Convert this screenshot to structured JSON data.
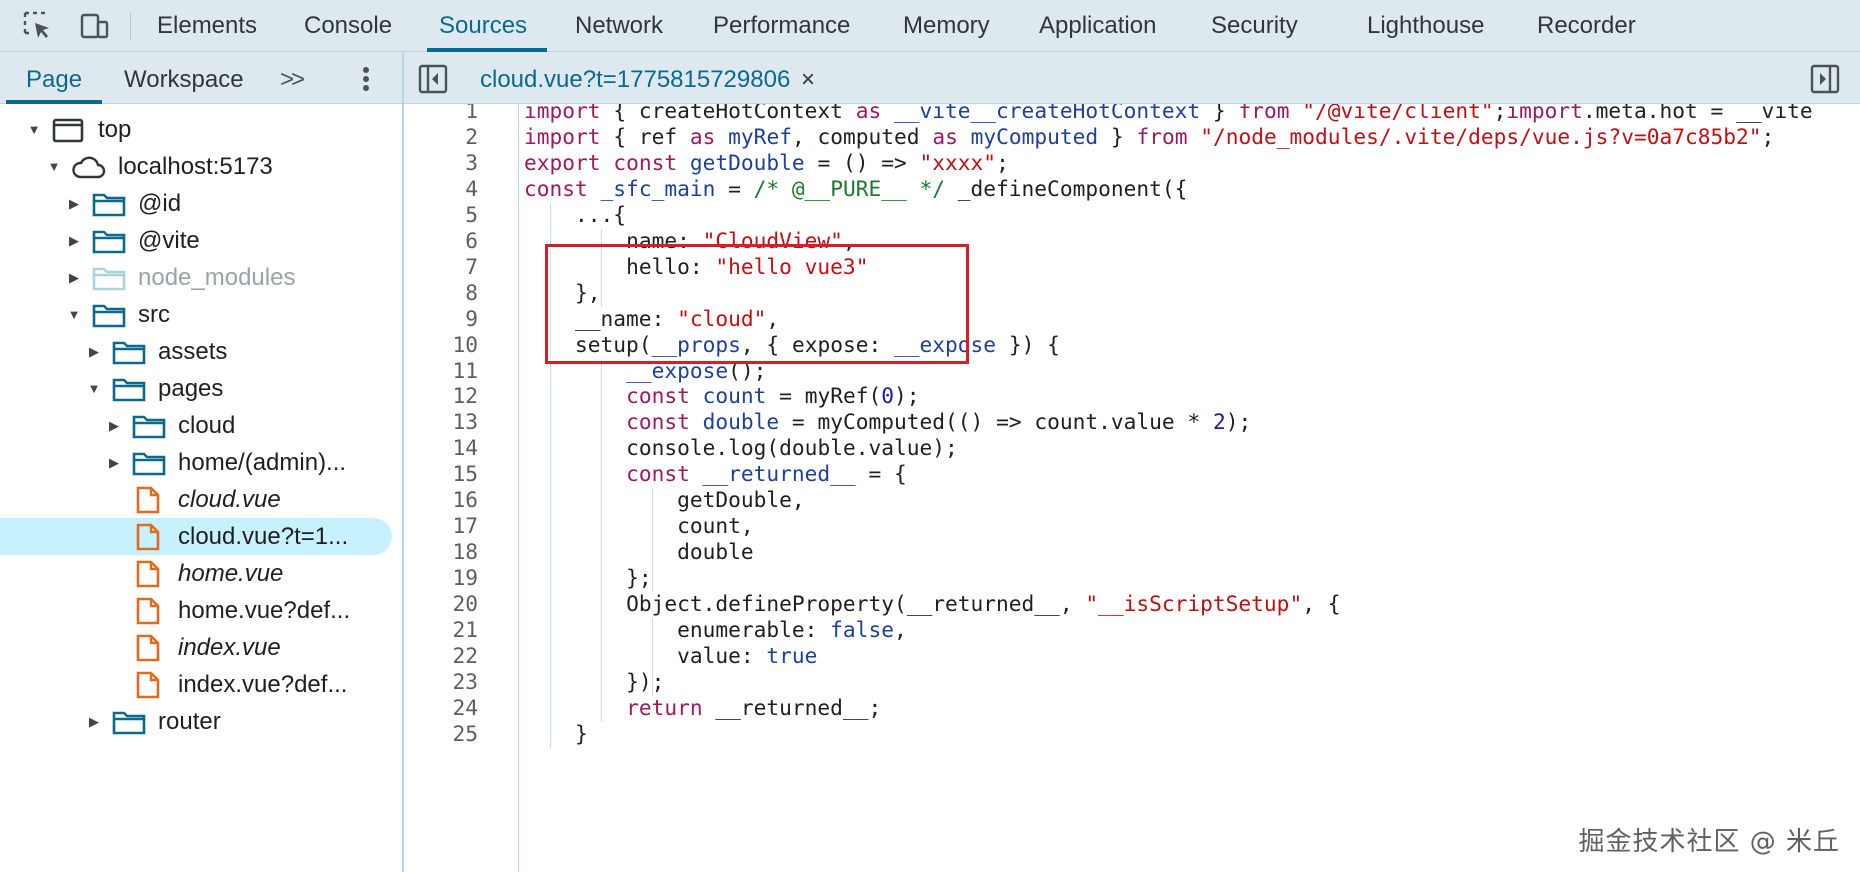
{
  "toolbar": {
    "tabs": [
      "Elements",
      "Console",
      "Sources",
      "Network",
      "Performance",
      "Memory",
      "Application",
      "Security",
      "Lighthouse",
      "Recorder"
    ],
    "active_tab": "Sources"
  },
  "navigator": {
    "tabs": [
      "Page",
      "Workspace"
    ],
    "more_label": ">>",
    "active_tab": "Page",
    "tree": [
      {
        "label": "top",
        "type": "frame",
        "expanded": true
      },
      {
        "label": "localhost:5173",
        "type": "cloud",
        "expanded": true
      },
      {
        "label": "@id",
        "type": "folder",
        "expanded": false
      },
      {
        "label": "@vite",
        "type": "folder",
        "expanded": false
      },
      {
        "label": "node_modules",
        "type": "folder",
        "expanded": false,
        "dimmed": true
      },
      {
        "label": "src",
        "type": "folder",
        "expanded": true
      },
      {
        "label": "assets",
        "type": "folder",
        "expanded": false
      },
      {
        "label": "pages",
        "type": "folder",
        "expanded": true
      },
      {
        "label": "cloud",
        "type": "folder",
        "expanded": false
      },
      {
        "label": "home/(admin)...",
        "type": "folder",
        "expanded": false
      },
      {
        "label": "cloud.vue",
        "type": "file",
        "italic": true
      },
      {
        "label": "cloud.vue?t=1...",
        "type": "file",
        "selected": true
      },
      {
        "label": "home.vue",
        "type": "file",
        "italic": true
      },
      {
        "label": "home.vue?def...",
        "type": "file"
      },
      {
        "label": "index.vue",
        "type": "file",
        "italic": true
      },
      {
        "label": "index.vue?def...",
        "type": "file"
      },
      {
        "label": "router",
        "type": "folder",
        "expanded": false
      }
    ]
  },
  "editor": {
    "file_tab": "cloud.vue?t=1775815729806",
    "close_icon": "×",
    "line_numbers": [
      "1",
      "2",
      "3",
      "4",
      "5",
      "6",
      "7",
      "8",
      "9",
      "10",
      "11",
      "12",
      "13",
      "14",
      "15",
      "16",
      "17",
      "18",
      "19",
      "20",
      "21",
      "22",
      "23",
      "24",
      "25"
    ],
    "code": [
      "import { createHotContext as __vite__createHotContext } from \"/@vite/client\";import.meta.hot = __vite",
      "import { ref as myRef, computed as myComputed } from \"/node_modules/.vite/deps/vue.js?v=0a7c85b2\";",
      "export const getDouble = () => \"xxxx\";",
      "const _sfc_main = /* @__PURE__ */ _defineComponent({",
      "    ...{",
      "        name: \"CloudView\",",
      "        hello: \"hello vue3\"",
      "    },",
      "    __name: \"cloud\",",
      "    setup(__props, { expose: __expose }) {",
      "        __expose();",
      "        const count = myRef(0);",
      "        const double = myComputed(() => count.value * 2);",
      "        console.log(double.value);",
      "        const __returned__ = {",
      "            getDouble,",
      "            count,",
      "            double",
      "        };",
      "        Object.defineProperty(__returned__, \"__isScriptSetup\", {",
      "            enumerable: false,",
      "            value: true",
      "        });",
      "        return __returned__;",
      "    }"
    ]
  },
  "watermark": "掘金技术社区 @ 米丘",
  "colors": {
    "accent": "#0b6a8c",
    "highlight_box": "#d4202a",
    "selected_row": "#c8f1ff"
  }
}
